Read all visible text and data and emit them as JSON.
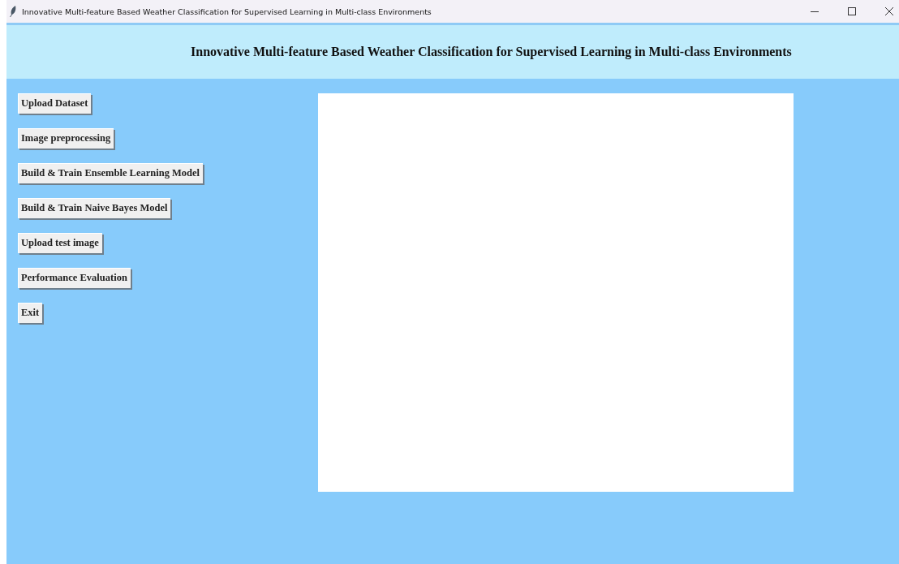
{
  "window": {
    "title": "Innovative Multi-feature Based Weather Classification for Supervised Learning in Multi-class Environments"
  },
  "header": {
    "title": "Innovative Multi-feature Based Weather Classification for Supervised Learning in Multi-class Environments"
  },
  "buttons": [
    {
      "label": "Upload Dataset"
    },
    {
      "label": "Image preprocessing"
    },
    {
      "label": "Build & Train Ensemble Learning Model"
    },
    {
      "label": "Build & Train Naive Bayes Model"
    },
    {
      "label": "Upload test image"
    },
    {
      "label": "Performance Evaluation"
    },
    {
      "label": "Exit"
    }
  ]
}
